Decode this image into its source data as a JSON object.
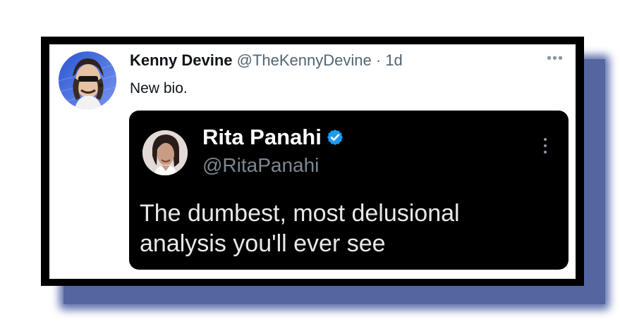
{
  "tweet": {
    "display_name": "Kenny Devine",
    "handle": "@TheKennyDevine",
    "separator": "·",
    "time": "1d",
    "text": "New bio.",
    "more_label": "•••",
    "avatar": "user-avatar"
  },
  "quote": {
    "display_name": "Rita Panahi",
    "handle": "@RitaPanahi",
    "text": "The dumbest, most delusional analysis you'll ever see",
    "verified_icon": "verified-badge-icon",
    "more_icon": "vertical-more-icon"
  },
  "colors": {
    "shadow": "#53669f",
    "frame": "#000000",
    "quote_bg": "#000000",
    "verified": "#1d9bf0",
    "meta_text": "#536471",
    "quote_handle": "#7d8791"
  }
}
